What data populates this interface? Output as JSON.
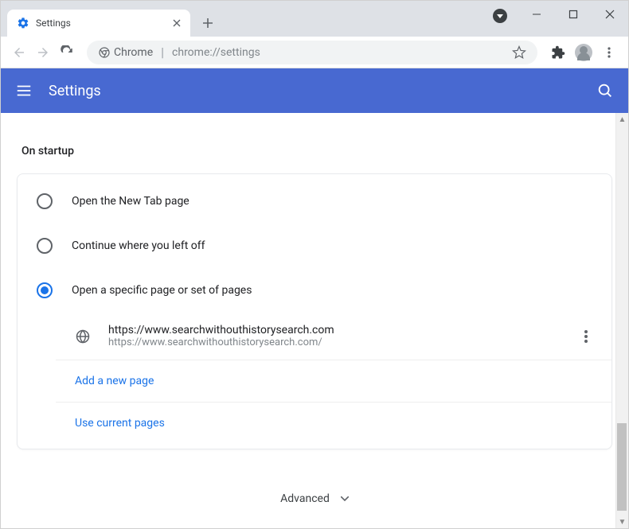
{
  "window": {
    "tab_title": "Settings"
  },
  "omnibox": {
    "label": "Chrome",
    "url": "chrome://settings"
  },
  "header": {
    "title": "Settings"
  },
  "startup": {
    "section_title": "On startup",
    "options": [
      {
        "label": "Open the New Tab page"
      },
      {
        "label": "Continue where you left off"
      },
      {
        "label": "Open a specific page or set of pages"
      }
    ],
    "page_entry": {
      "display": "https://www.searchwithouthistorysearch.com",
      "url": "https://www.searchwithouthistorysearch.com/"
    },
    "add_page": "Add a new page",
    "use_current": "Use current pages"
  },
  "advanced": {
    "label": "Advanced"
  }
}
